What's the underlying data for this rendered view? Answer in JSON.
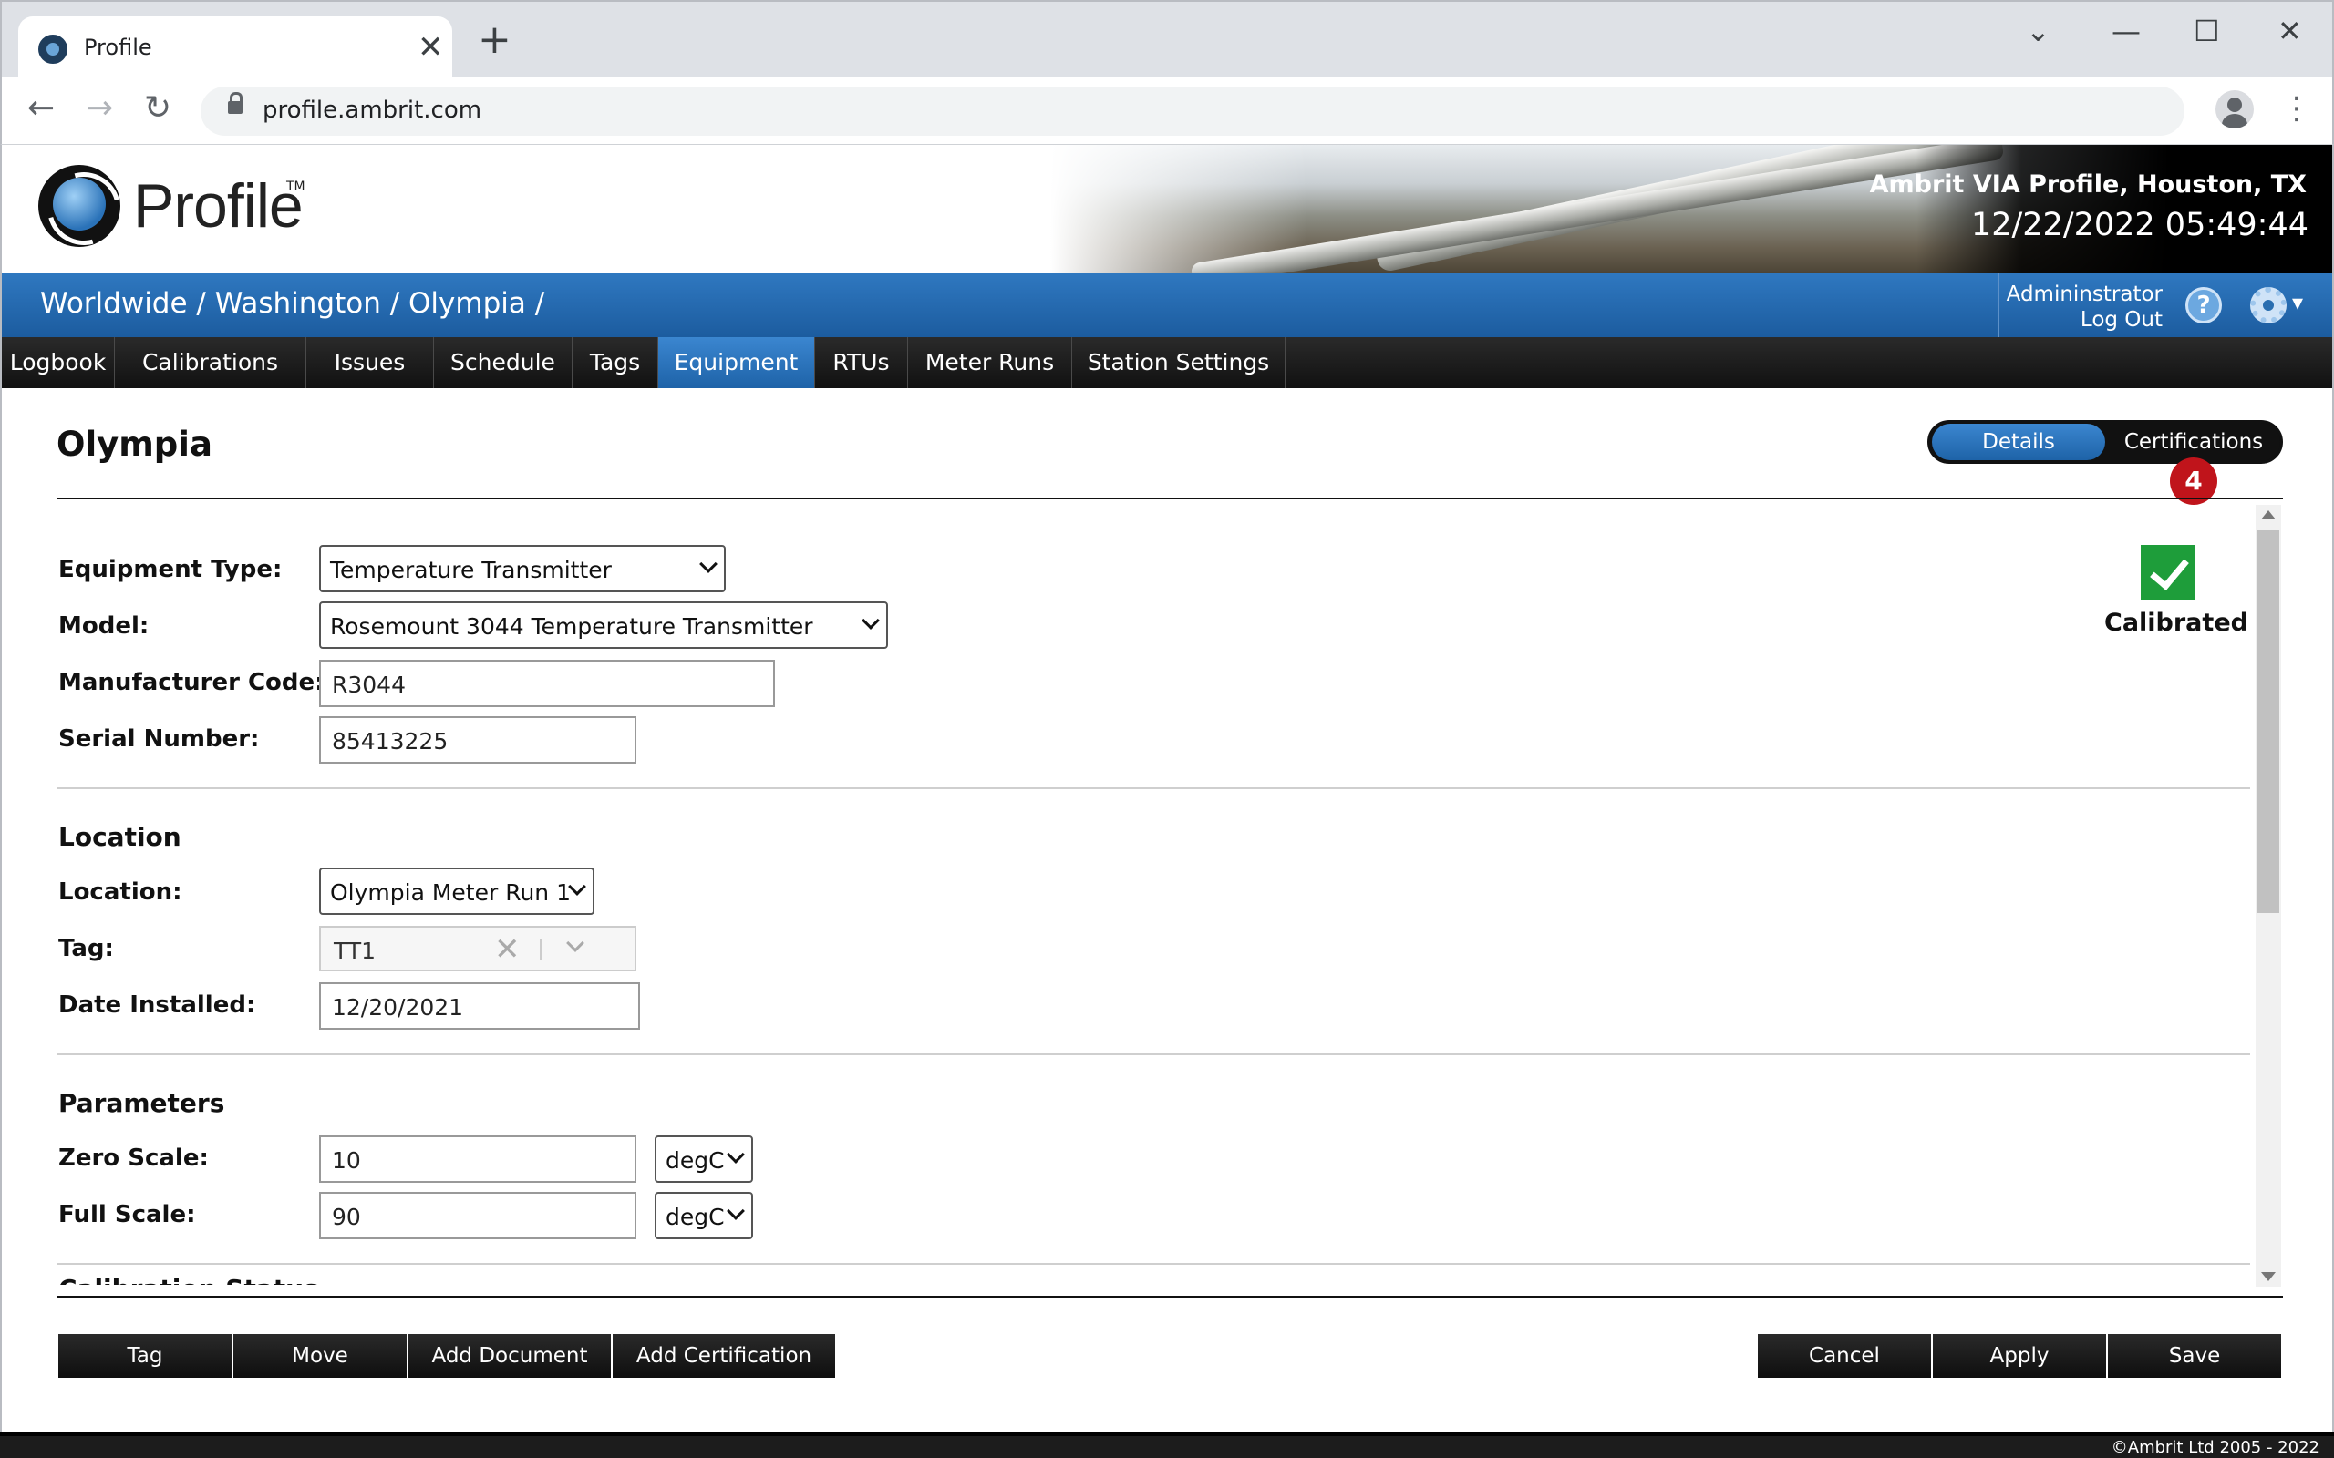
{
  "browser": {
    "tab_title": "Profile",
    "tab_close": "✕",
    "new_tab": "+",
    "url": "profile.ambrit.com",
    "back": "←",
    "forward": "→",
    "reload": "↻",
    "menu": "⋮",
    "win_dropdown": "⌄",
    "win_min": "—",
    "win_max": "☐",
    "win_close": "✕"
  },
  "header": {
    "logo_text": "Profile",
    "logo_tm": "TM",
    "site_name": "Ambrit VIA Profile, Houston, TX",
    "datetime": "12/22/2022 05:49:44"
  },
  "breadcrumb": "Worldwide / Washington / Olympia /",
  "user": {
    "name": "Admininstrator",
    "logout": "Log Out",
    "help": "?",
    "gear_caret": "▾"
  },
  "nav": {
    "items": [
      {
        "label": "Logbook"
      },
      {
        "label": "Calibrations"
      },
      {
        "label": "Issues"
      },
      {
        "label": "Schedule"
      },
      {
        "label": "Tags"
      },
      {
        "label": "Equipment",
        "active": true
      },
      {
        "label": "RTUs"
      },
      {
        "label": "Meter Runs"
      },
      {
        "label": "Station Settings"
      }
    ]
  },
  "page": {
    "title": "Olympia",
    "toggle_details": "Details",
    "toggle_certifications": "Certifications",
    "cert_badge": "4",
    "status_label": "Calibrated"
  },
  "form": {
    "equipment_type_label": "Equipment Type:",
    "equipment_type_value": "Temperature Transmitter",
    "model_label": "Model:",
    "model_value": "Rosemount 3044 Temperature Transmitter",
    "manufacturer_code_label": "Manufacturer Code:",
    "manufacturer_code_value": "R3044",
    "serial_number_label": "Serial Number:",
    "serial_number_value": "85413225",
    "location_section": "Location",
    "location_label": "Location:",
    "location_value": "Olympia Meter Run 1",
    "tag_label": "Tag:",
    "tag_value": "TT1",
    "date_installed_label": "Date Installed:",
    "date_installed_value": "12/20/2021",
    "parameters_section": "Parameters",
    "zero_scale_label": "Zero Scale:",
    "zero_scale_value": "10",
    "zero_scale_unit": "degC",
    "full_scale_label": "Full Scale:",
    "full_scale_value": "90",
    "full_scale_unit": "degC",
    "calibration_status_section": "Calibration Status"
  },
  "actions": {
    "tag": "Tag",
    "move": "Move",
    "add_document": "Add Document",
    "add_certification": "Add Certification",
    "cancel": "Cancel",
    "apply": "Apply",
    "save": "Save"
  },
  "footer": "©Ambrit Ltd 2005 - 2022"
}
